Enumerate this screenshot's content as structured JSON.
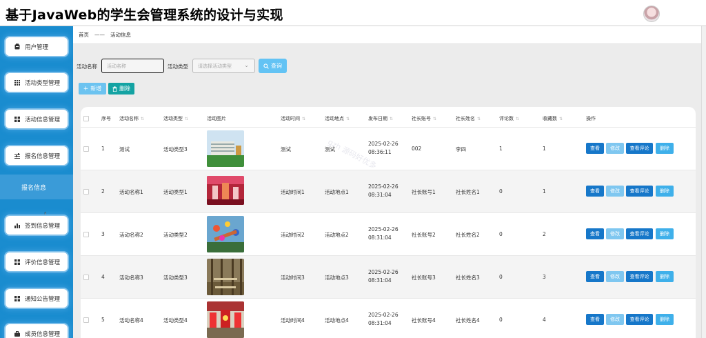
{
  "app": {
    "title": "基于JavaWeb的学生会管理系统的设计与实现"
  },
  "sidebar": {
    "items": [
      {
        "label": "用户管理",
        "icon": "clipboard-icon"
      },
      {
        "label": "活动类型管理",
        "icon": "grid-icon"
      },
      {
        "label": "活动信息管理",
        "icon": "apps-icon"
      },
      {
        "label": "报名信息管理",
        "icon": "sliders-icon"
      },
      {
        "label": "签到信息管理",
        "icon": "bar-chart-icon"
      },
      {
        "label": "评价信息管理",
        "icon": "apps-icon"
      },
      {
        "label": "通知公告管理",
        "icon": "apps-icon"
      },
      {
        "label": "成员信息管理",
        "icon": "briefcase-icon"
      }
    ],
    "active_sub": "报名信息"
  },
  "breadcrumb": {
    "home": "首页",
    "separator": "——",
    "current": "活动信息"
  },
  "filters": {
    "name_label": "活动名称",
    "name_placeholder": "活动名称",
    "type_label": "活动类型",
    "type_placeholder": "请选择活动类型",
    "query_label": "查询"
  },
  "actions": {
    "add_label": "新增",
    "delete_label": "删除"
  },
  "table": {
    "headers": {
      "index": "序号",
      "name": "活动名称",
      "type": "活动类型",
      "image": "活动图片",
      "time": "活动时间",
      "place": "活动地点",
      "date": "发布日期",
      "account": "社长账号",
      "leader": "社长姓名",
      "comments": "评论数",
      "favorites": "收藏数",
      "ops": "操作"
    },
    "row_actions": {
      "view": "查看",
      "edit": "修改",
      "review": "查看评论",
      "delete": "删除"
    },
    "rows": [
      {
        "index": "1",
        "name": "测试",
        "type": "活动类型3",
        "time": "测试",
        "place": "测试",
        "date": "2025-02-26 08:36:11",
        "account": "002",
        "leader": "李四",
        "comments": "1",
        "favorites": "1"
      },
      {
        "index": "2",
        "name": "活动名称1",
        "type": "活动类型1",
        "time": "活动时间1",
        "place": "活动地点1",
        "date": "2025-02-26 08:31:04",
        "account": "社长账号1",
        "leader": "社长姓名1",
        "comments": "0",
        "favorites": "1"
      },
      {
        "index": "3",
        "name": "活动名称2",
        "type": "活动类型2",
        "time": "活动时间2",
        "place": "活动地点2",
        "date": "2025-02-26 08:31:04",
        "account": "社长账号2",
        "leader": "社长姓名2",
        "comments": "0",
        "favorites": "2"
      },
      {
        "index": "4",
        "name": "活动名称3",
        "type": "活动类型3",
        "time": "活动时间3",
        "place": "活动地点3",
        "date": "2025-02-26 08:31:04",
        "account": "社长账号3",
        "leader": "社长姓名3",
        "comments": "0",
        "favorites": "3"
      },
      {
        "index": "5",
        "name": "活动名称4",
        "type": "活动类型4",
        "time": "活动时间4",
        "place": "活动地点4",
        "date": "2025-02-26 08:31:04",
        "account": "社长账号4",
        "leader": "社长姓名4",
        "comments": "0",
        "favorites": "4"
      }
    ]
  },
  "watermark": "gzh 源码好优多",
  "colors": {
    "sidebar": "#1a8ccf",
    "primary": "#1677c9",
    "light": "#7fc7f0",
    "teal": "#14a3a3"
  }
}
